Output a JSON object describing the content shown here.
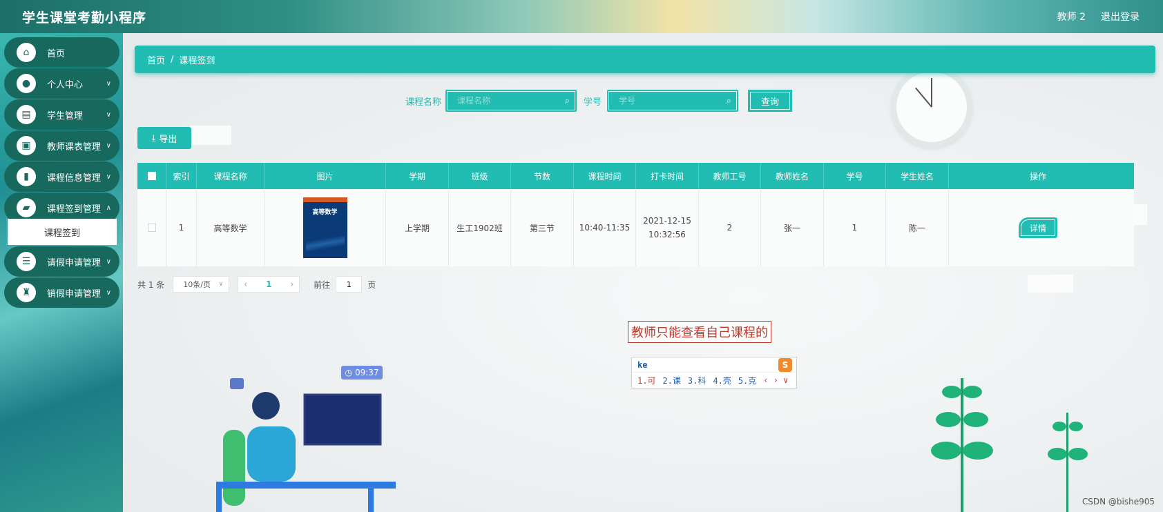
{
  "header": {
    "title": "学生课堂考勤小程序",
    "user": "教师 2",
    "logout": "退出登录"
  },
  "sidebar": {
    "items": [
      {
        "label": "首页",
        "icon": "home-icon",
        "chevron": false
      },
      {
        "label": "个人中心",
        "icon": "user-icon",
        "chevron": true
      },
      {
        "label": "学生管理",
        "icon": "clipboard-icon",
        "chevron": true
      },
      {
        "label": "教师课表管理",
        "icon": "briefcase-icon",
        "chevron": true
      },
      {
        "label": "课程信息管理",
        "icon": "book-icon",
        "chevron": true
      },
      {
        "label": "课程签到管理",
        "icon": "folder-icon",
        "chevron": true
      },
      {
        "label": "请假申请管理",
        "icon": "sliders-icon",
        "chevron": true
      },
      {
        "label": "销假申请管理",
        "icon": "stamp-icon",
        "chevron": true
      }
    ],
    "active_sub": "课程签到"
  },
  "breadcrumb": {
    "home": "首页",
    "sep": "/",
    "current": "课程签到"
  },
  "search": {
    "course_label": "课程名称",
    "course_placeholder": "课程名称",
    "sid_label": "学号",
    "sid_placeholder": "学号",
    "query": "查询"
  },
  "export": "导出",
  "table": {
    "headers": [
      "索引",
      "课程名称",
      "图片",
      "学期",
      "班级",
      "节数",
      "课程时间",
      "打卡时间",
      "教师工号",
      "教师姓名",
      "学号",
      "学生姓名",
      "操作"
    ],
    "row": {
      "index": "1",
      "course": "高等数学",
      "book_title": "高等数学",
      "term": "上学期",
      "class": "生工1902班",
      "section": "第三节",
      "time": "10:40-11:35",
      "checkin": "2021-12-15 10:32:56",
      "teacher_id": "2",
      "teacher_name": "张一",
      "sid": "1",
      "student_name": "陈一",
      "action": "详情"
    }
  },
  "pager": {
    "total": "共 1 条",
    "page_size": "10条/页",
    "page": "1",
    "goto_label": "前往",
    "goto_value": "1",
    "page_unit": "页"
  },
  "annotation": "教师只能查看自己课程的",
  "ime": {
    "input": "ke",
    "candidates": [
      "1.可",
      "2.课",
      "3.科",
      "4.壳",
      "5.克"
    ],
    "logo": "S"
  },
  "time_badge": "09:37",
  "watermark": "CSDN @bishe905"
}
